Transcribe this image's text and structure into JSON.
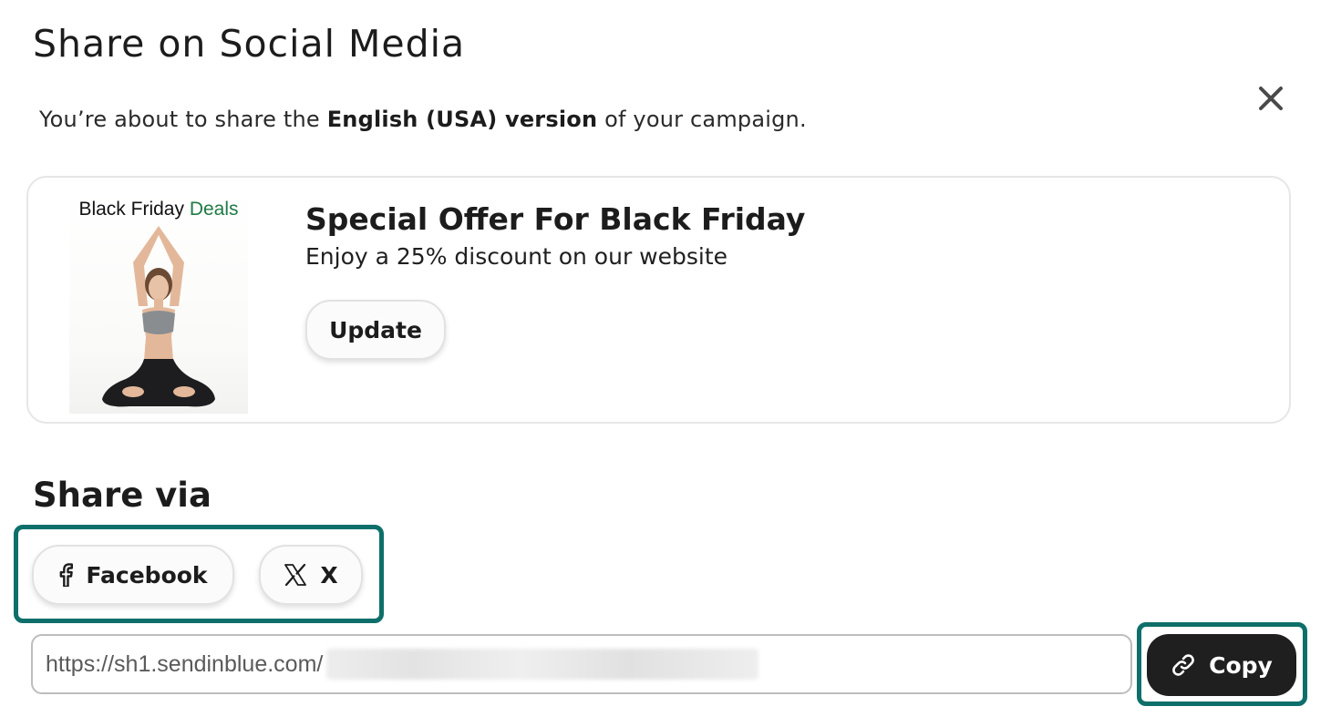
{
  "modal": {
    "title": "Share on Social Media",
    "subtitle_before": "You’re about to share the ",
    "subtitle_bold": "English (USA) version",
    "subtitle_after": " of your campaign."
  },
  "preview": {
    "thumbnail_title": "Black Friday ",
    "thumbnail_accent": "Deals",
    "offer_title": "Special Offer For Black Friday",
    "offer_description": "Enjoy a 25% discount on our website",
    "update_label": "Update"
  },
  "share": {
    "heading": "Share via",
    "facebook_label": "Facebook",
    "x_label": "X",
    "url_value": "https://sh1.sendinblue.com/",
    "copy_label": "Copy"
  },
  "colors": {
    "highlight_border": "#0e6f6a",
    "deals_accent": "#1f7a45",
    "copy_button_bg": "#1f1f1f"
  },
  "icons": [
    "close-icon",
    "facebook-icon",
    "x-logo-icon",
    "link-icon"
  ]
}
